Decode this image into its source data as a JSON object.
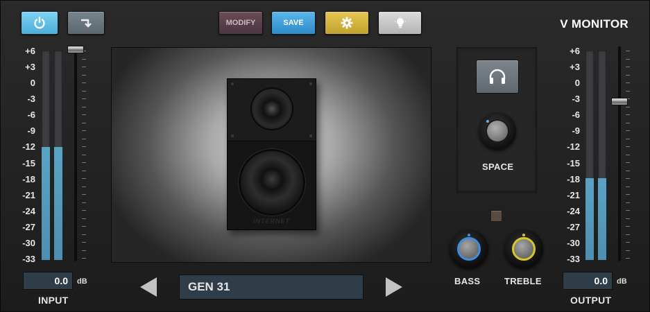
{
  "title": "V MONITOR",
  "toolbar": {
    "power_icon": "power-icon",
    "bypass_icon": "bypass-arrow-icon",
    "modify_label": "MODIFY",
    "save_label": "SAVE",
    "settings_icon": "gear-icon",
    "light_icon": "lightbulb-icon"
  },
  "colors": {
    "power_active": "#56b9e0",
    "bypass": "#66747c",
    "modify": "#5a3f49",
    "save": "#3a9ad3",
    "settings": "#d2b33c",
    "light": "#c5c5c5",
    "meter_fill": "#5aa3c5",
    "value_box": "#2f3d48",
    "bass_ring": "#3a8fe0",
    "treble_ring": "#d8c72a"
  },
  "meter_scale": [
    "+6",
    "+3",
    "0",
    "-3",
    "-6",
    "-9",
    "-12",
    "-15",
    "-18",
    "-21",
    "-24",
    "-27",
    "-30",
    "-33"
  ],
  "input": {
    "label": "INPUT",
    "value": "0.0",
    "unit": "dB",
    "meter_left_level": 0.54,
    "meter_right_level": 0.54,
    "fader_position": 1.0
  },
  "output": {
    "label": "OUTPUT",
    "value": "0.0",
    "unit": "dB",
    "meter_left_level": 0.39,
    "meter_right_level": 0.39,
    "fader_position": 0.75
  },
  "speaker": {
    "brand": "INTERNET"
  },
  "preset": {
    "name": "GEN 31",
    "prev_icon": "triangle-left-icon",
    "next_icon": "triangle-right-icon"
  },
  "space": {
    "label": "SPACE",
    "headphones_icon": "headphones-icon"
  },
  "bass": {
    "label": "BASS"
  },
  "treble": {
    "label": "TREBLE"
  }
}
